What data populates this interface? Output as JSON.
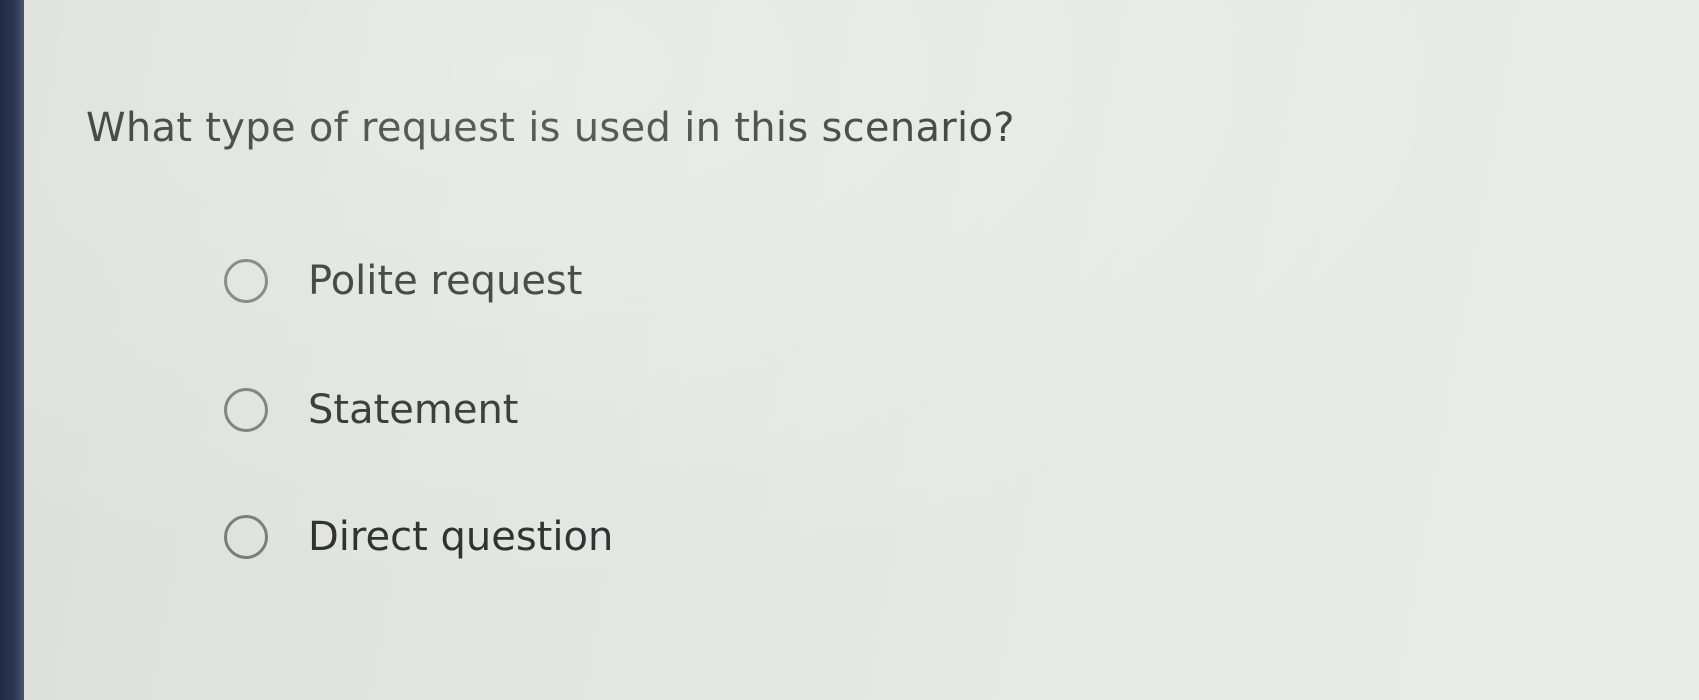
{
  "question": {
    "text": "What type of request is used in this scenario?"
  },
  "options": [
    {
      "label": "Polite request",
      "selected": false
    },
    {
      "label": "Statement",
      "selected": false
    },
    {
      "label": "Direct question",
      "selected": false
    }
  ],
  "colors": {
    "background": "#e2e5e0",
    "text": "#2c2c2c",
    "radio_border": "#7a7a7a",
    "bezel": "#1f2a44"
  }
}
